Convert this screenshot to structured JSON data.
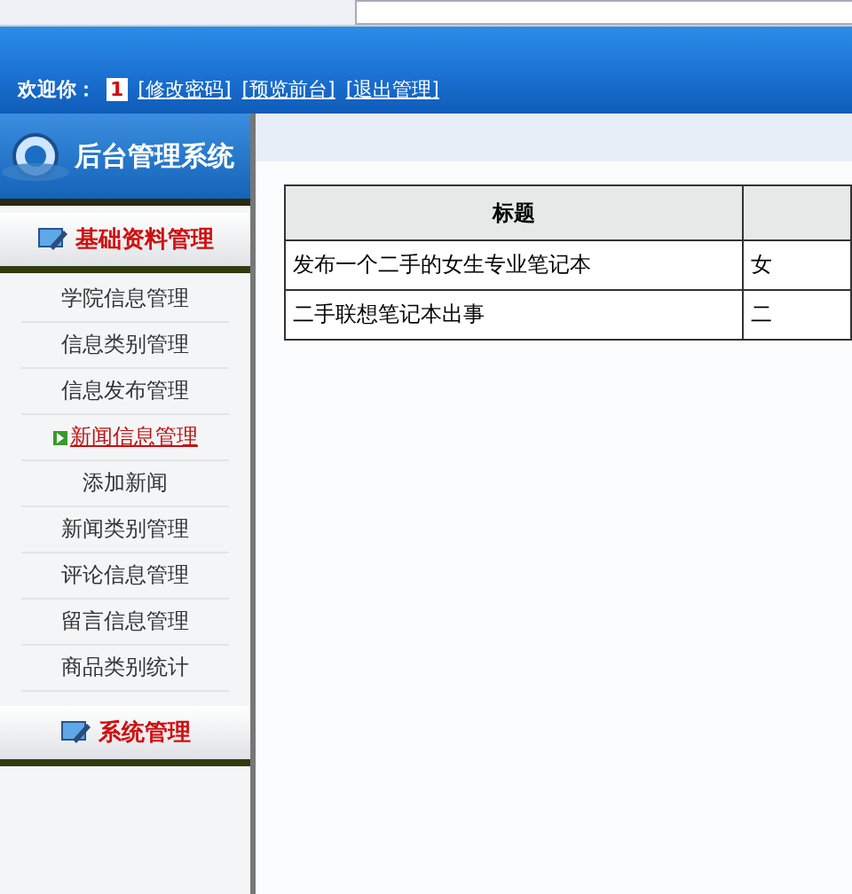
{
  "header": {
    "welcome": "欢迎你：",
    "username": "1",
    "links": [
      "[修改密码]",
      "[预览前台]",
      "[退出管理]"
    ]
  },
  "sidebar": {
    "logo_title": "后台管理系统",
    "sections": [
      {
        "title": "基础资料管理",
        "items": [
          {
            "label": "学院信息管理",
            "selected": false
          },
          {
            "label": "信息类别管理",
            "selected": false
          },
          {
            "label": "信息发布管理",
            "selected": false
          },
          {
            "label": "新闻信息管理",
            "selected": true
          },
          {
            "label": "添加新闻",
            "selected": false
          },
          {
            "label": "新闻类别管理",
            "selected": false
          },
          {
            "label": "评论信息管理",
            "selected": false
          },
          {
            "label": "留言信息管理",
            "selected": false
          },
          {
            "label": "商品类别统计",
            "selected": false
          }
        ]
      },
      {
        "title": "系统管理"
      }
    ]
  },
  "table": {
    "columns": [
      "标题"
    ],
    "rows": [
      [
        "发布一个二手的女生专业笔记本",
        "女"
      ],
      [
        "二手联想笔记本出事",
        "二"
      ]
    ]
  }
}
